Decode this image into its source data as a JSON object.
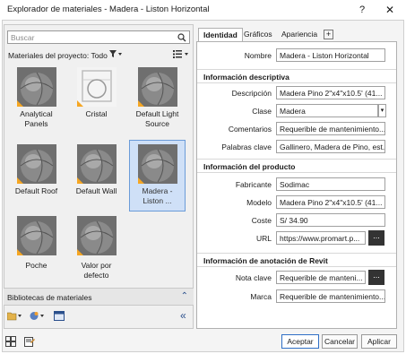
{
  "window": {
    "title": "Explorador de materiales - Madera - Liston Horizontal",
    "help": "?",
    "close": "✕"
  },
  "left": {
    "search_placeholder": "Buscar",
    "project_label": "Materiales del proyecto: Todo",
    "materials": [
      {
        "label": "Analytical Panels",
        "selected": false
      },
      {
        "label": "Cristal",
        "selected": false
      },
      {
        "label": "Default Light Source",
        "selected": false
      },
      {
        "label": "Default Roof",
        "selected": false
      },
      {
        "label": "Default Wall",
        "selected": false
      },
      {
        "label": "Madera - Liston ...",
        "selected": true
      },
      {
        "label": "Poche",
        "selected": false
      },
      {
        "label": "Valor por defecto",
        "selected": false
      }
    ],
    "libraries_label": "Bibliotecas de materiales"
  },
  "tabs": [
    {
      "label": "Identidad",
      "active": true
    },
    {
      "label": "Gráficos",
      "active": false
    },
    {
      "label": "Apariencia",
      "active": false
    }
  ],
  "props": {
    "nombre": {
      "label": "Nombre",
      "value": "Madera - Liston Horizontal"
    },
    "sect_desc": "Información descriptiva",
    "descripcion": {
      "label": "Descripción",
      "value": "Madera Pino 2\"x4\"x10.5' (41..."
    },
    "clase": {
      "label": "Clase",
      "value": "Madera"
    },
    "comentarios": {
      "label": "Comentarios",
      "value": "Requerible de mantenimiento..."
    },
    "palabras": {
      "label": "Palabras clave",
      "value": "Gallinero, Madera de Pino, est..."
    },
    "sect_prod": "Información del producto",
    "fabricante": {
      "label": "Fabricante",
      "value": "Sodimac"
    },
    "modelo": {
      "label": "Modelo",
      "value": "Madera Pino 2\"x4\"x10.5' (41..."
    },
    "coste": {
      "label": "Coste",
      "value": "S/ 34.90"
    },
    "url": {
      "label": "URL",
      "value": "https://www.promart.p..."
    },
    "sect_revit": "Información de anotación de Revit",
    "nota": {
      "label": "Nota clave",
      "value": "Requerible de manteni..."
    },
    "marca": {
      "label": "Marca",
      "value": "Requerible de mantenimiento..."
    }
  },
  "buttons": {
    "aceptar": "Aceptar",
    "cancelar": "Cancelar",
    "aplicar": "Aplicar",
    "dots": "..."
  },
  "colors": {
    "selection": "#cfe0f7",
    "accent_corner": "#f5a623",
    "primary_border": "#2f6fc6"
  }
}
